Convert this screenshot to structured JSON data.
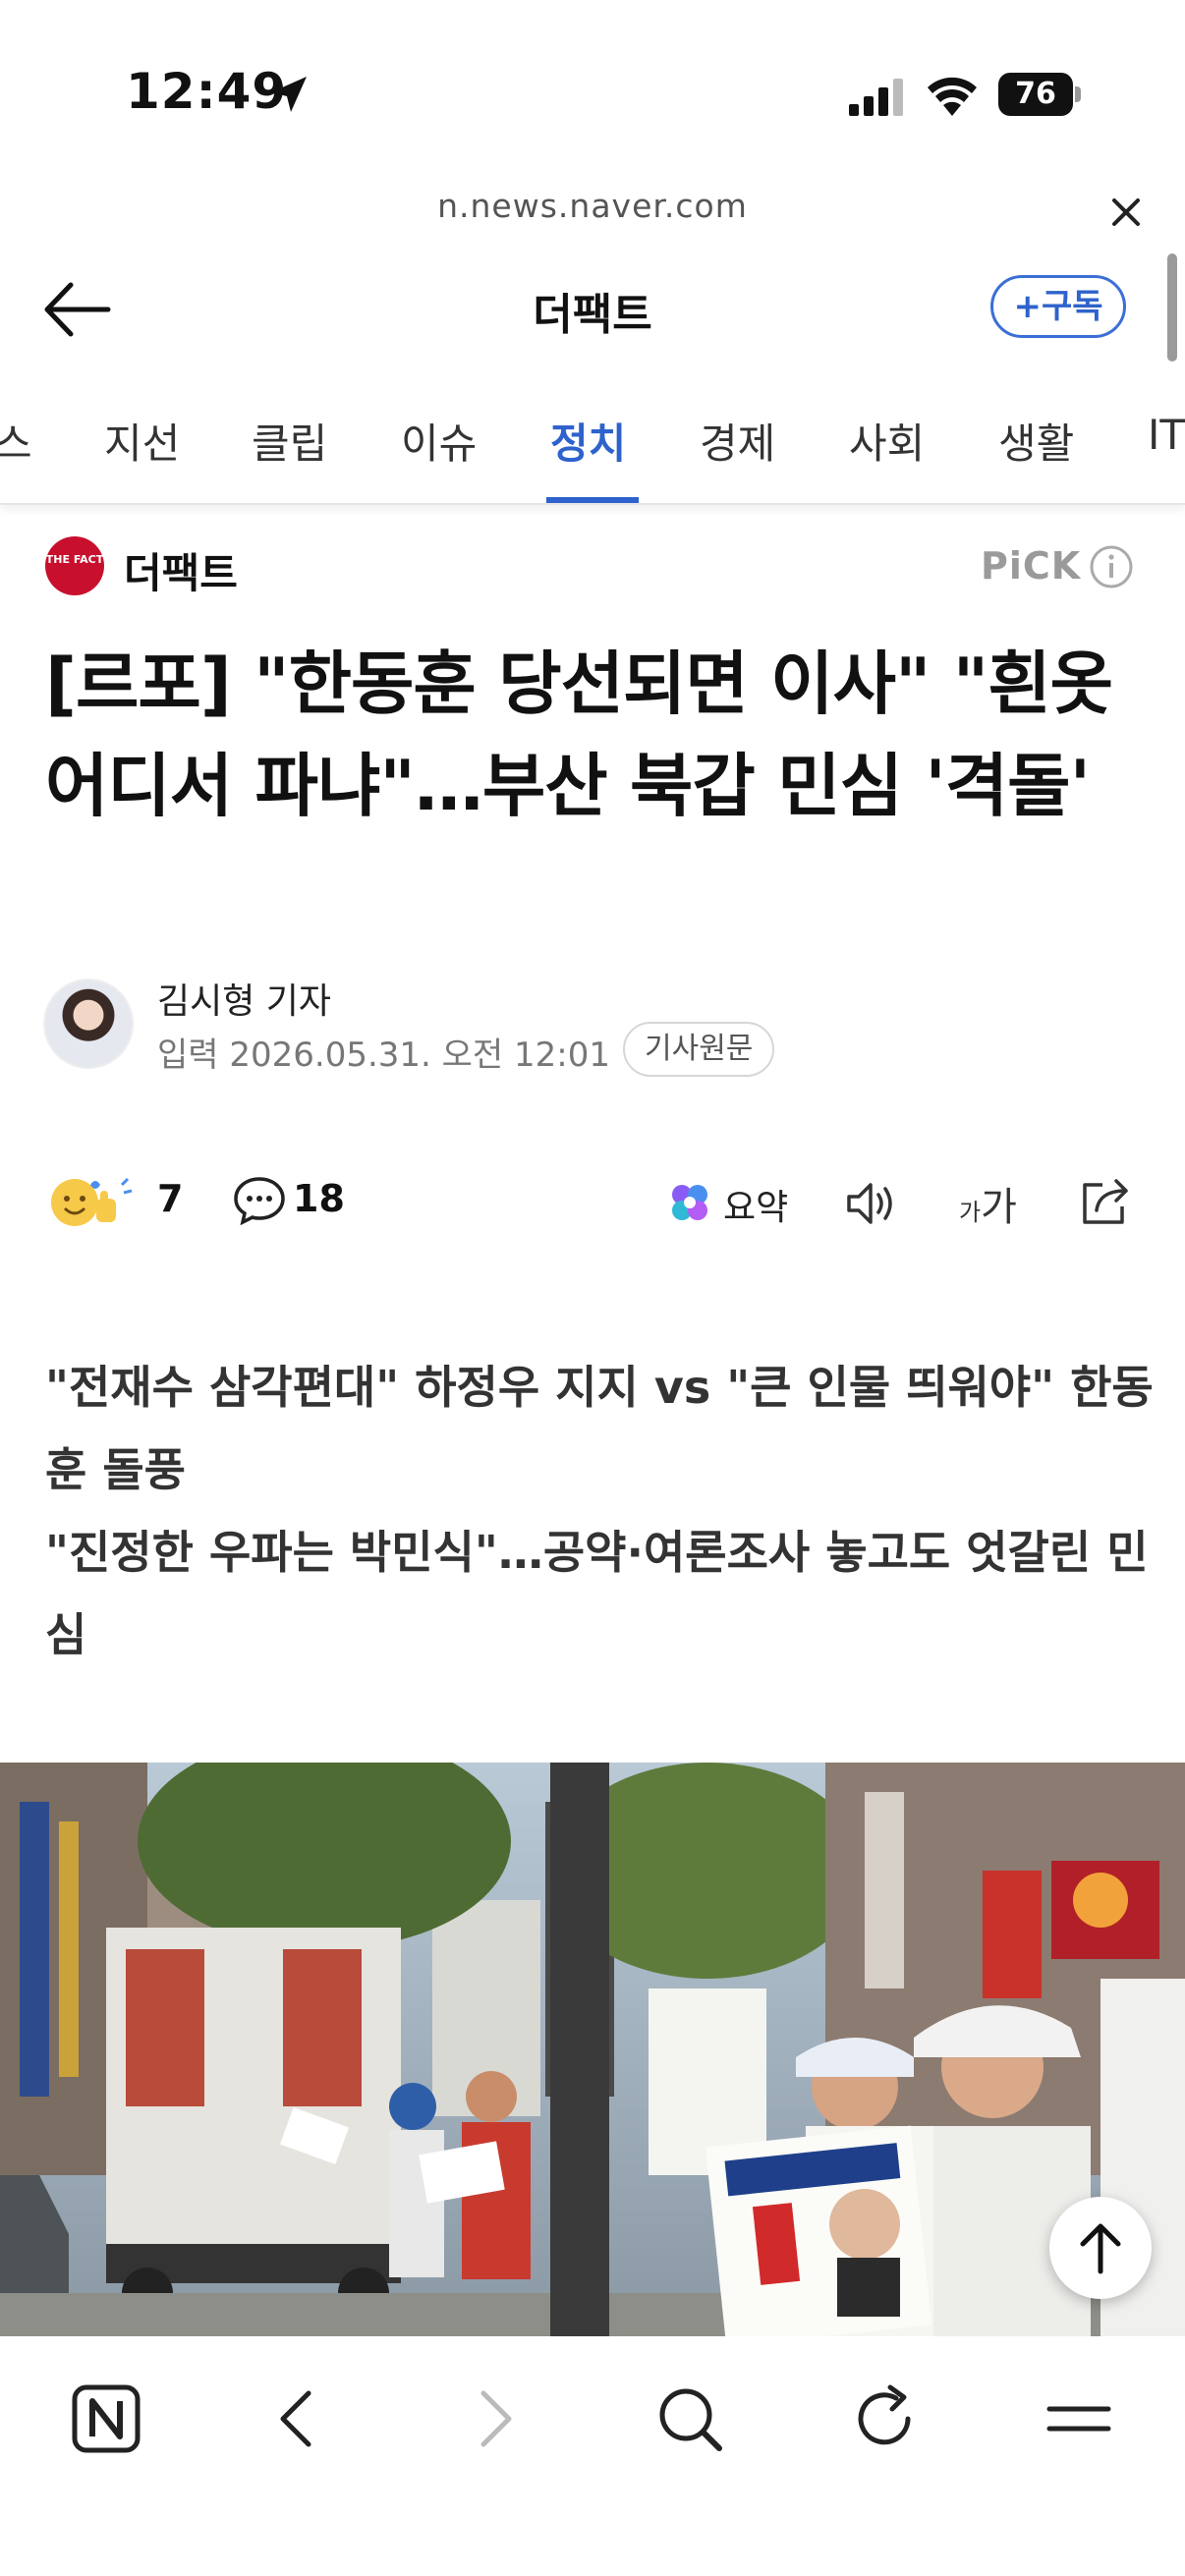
{
  "status_bar": {
    "time": "12:49",
    "battery": "76"
  },
  "url_bar": {
    "url": "n.news.naver.com"
  },
  "header": {
    "press_title": "더팩트",
    "subscribe_label": "+구독"
  },
  "tabs": [
    {
      "label": "스"
    },
    {
      "label": "지선"
    },
    {
      "label": "클립"
    },
    {
      "label": "이슈"
    },
    {
      "label": "정치",
      "active": true
    },
    {
      "label": "경제"
    },
    {
      "label": "사회"
    },
    {
      "label": "생활"
    },
    {
      "label": "IT"
    }
  ],
  "press": {
    "logo_text": "THE FACT",
    "name": "더팩트",
    "pick_label": "PiCK"
  },
  "article": {
    "headline": "[르포] \"한동훈 당선되면 이사\" \"흰옷 어디서 파냐\"…부산 북갑 민심 '격돌'",
    "reporter": "김시형 기자",
    "published": "입력 2026.05.31. 오전 12:01",
    "original_label": "기사원문",
    "subhead_lines": [
      "\"전재수 삼각편대\" 하정우 지지 vs \"큰 인물 띄워야\" 한동훈 돌풍",
      "\"진정한 우파는 박민식\"…공약·여론조사 놓고도 엇갈린 민심"
    ]
  },
  "actions": {
    "reaction_count": "7",
    "comment_count": "18",
    "summary_label": "요약",
    "font_small": "가",
    "font_large": "가"
  },
  "colors": {
    "accent": "#2e62cc",
    "press_red": "#c8102e"
  },
  "icons": [
    "location-arrow-icon",
    "signal-icon",
    "wifi-icon",
    "close-icon",
    "back-arrow-icon",
    "info-icon",
    "reaction-emoji-icon",
    "comment-icon",
    "summary-sparkle-icon",
    "tts-speaker-icon",
    "share-icon",
    "naver-home-icon",
    "back-icon",
    "forward-icon",
    "search-icon",
    "reload-icon",
    "menu-icon",
    "scroll-top-icon"
  ]
}
